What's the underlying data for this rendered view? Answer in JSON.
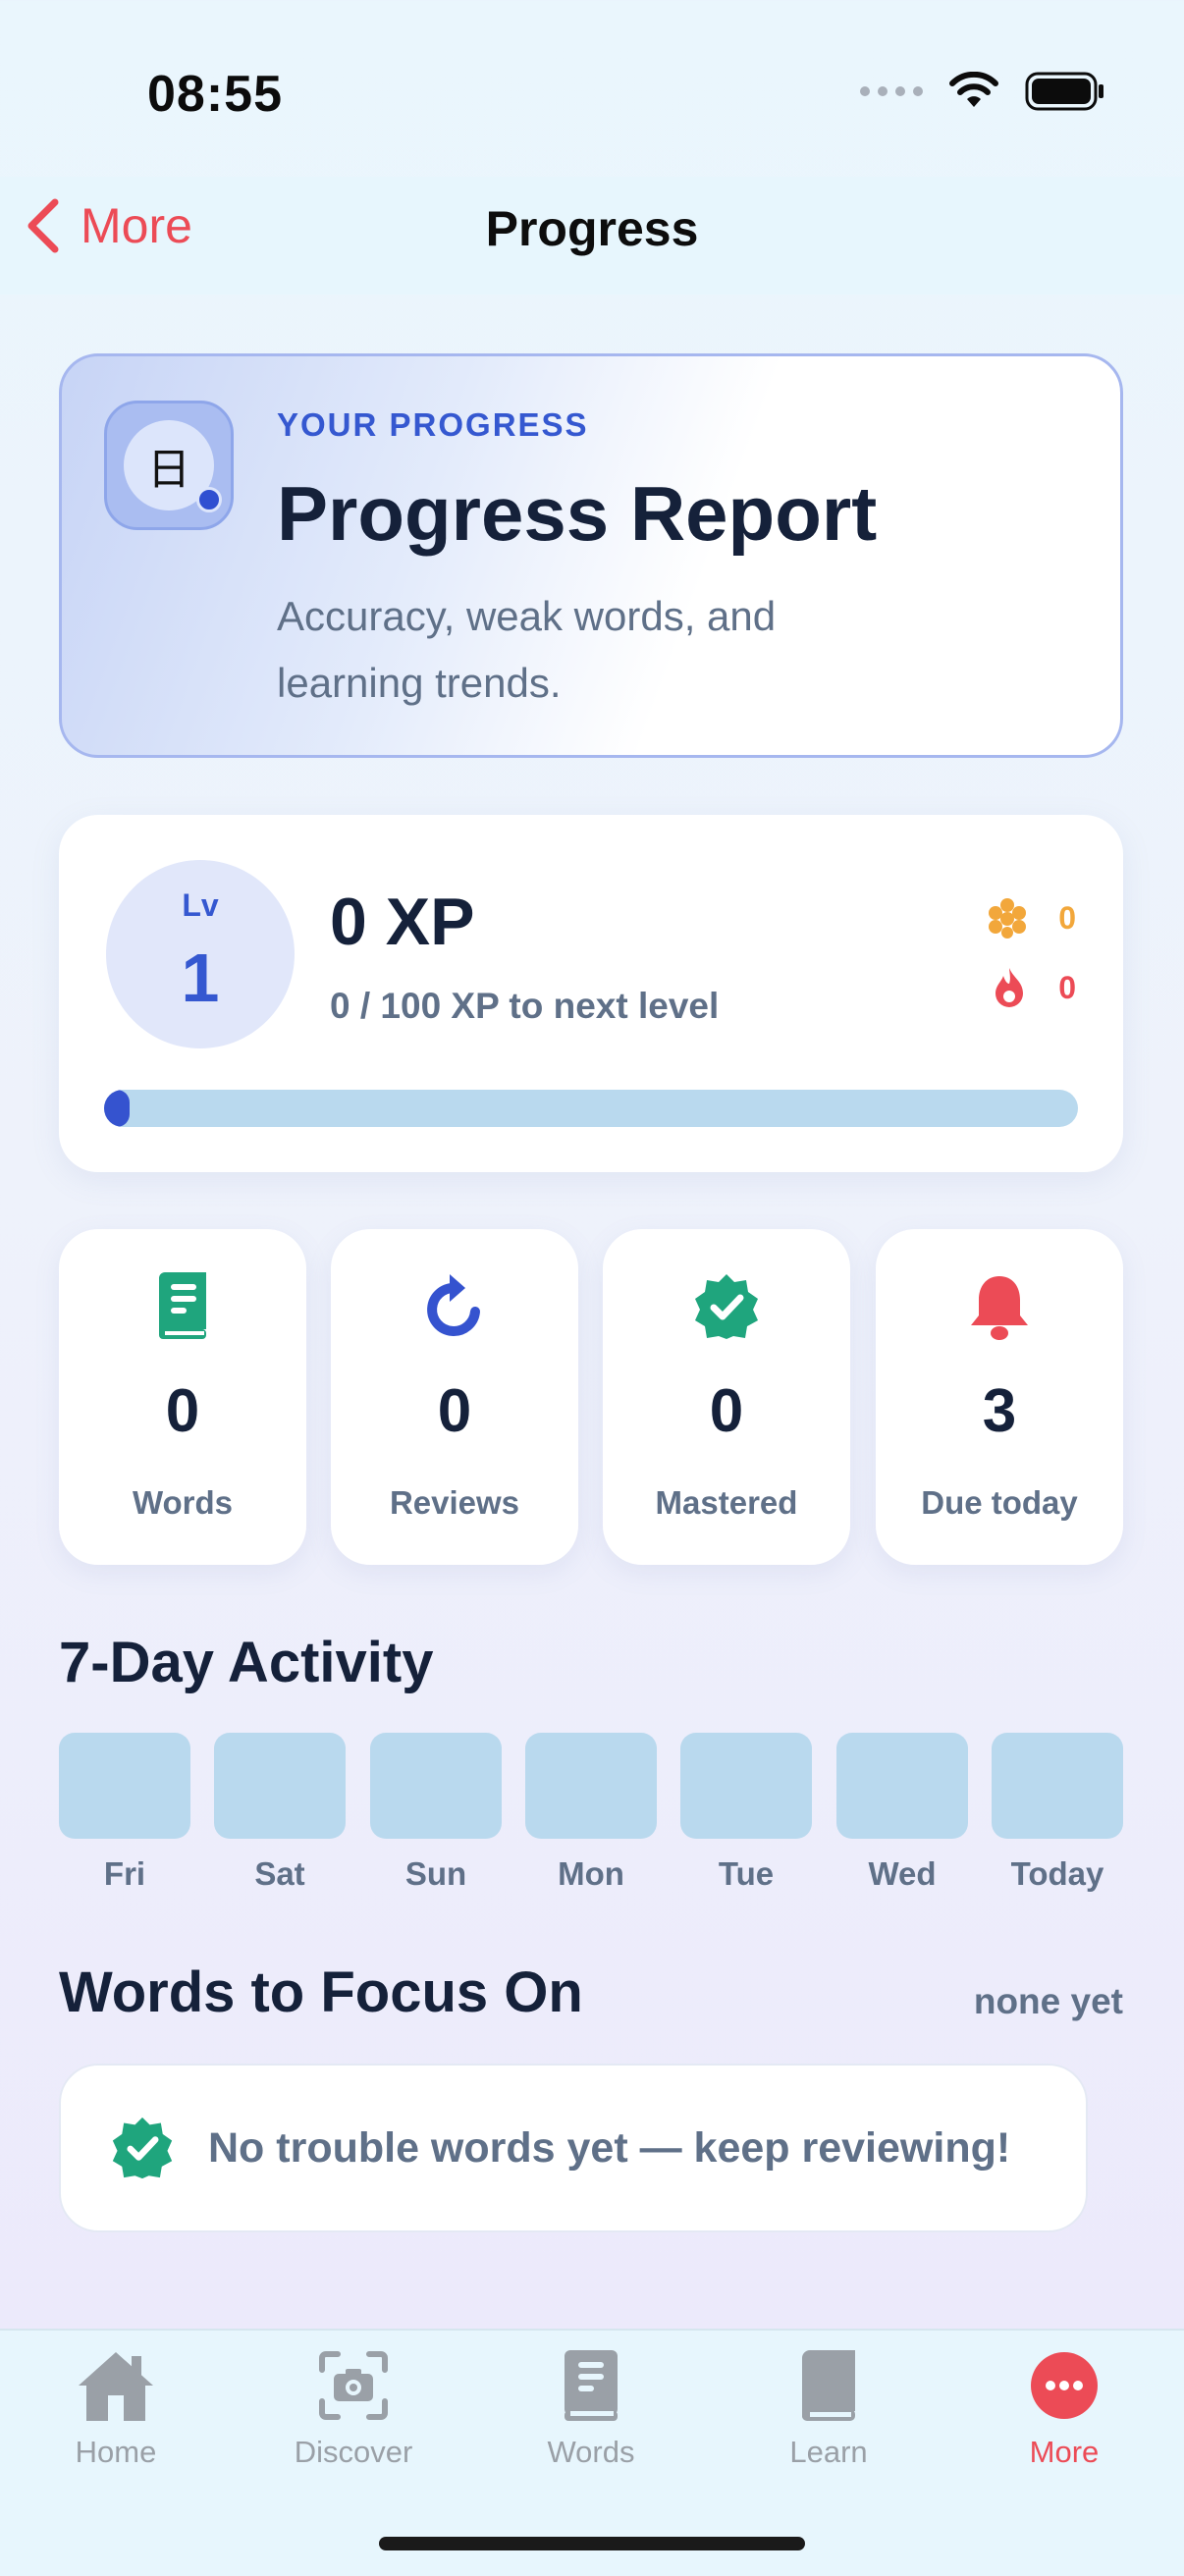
{
  "status_bar": {
    "time": "08:55"
  },
  "nav": {
    "back_label": "More",
    "title": "Progress"
  },
  "hero": {
    "icon_glyph": "日",
    "eyebrow": "YOUR PROGRESS",
    "title": "Progress Report",
    "subtitle": "Accuracy, weak words, and learning trends."
  },
  "level": {
    "lv_label": "Lv",
    "lv_value": "1",
    "xp": "0 XP",
    "xp_to_next": "0 / 100 XP to next level",
    "honey_count": "0",
    "streak_count": "0",
    "progress_fraction": 0.0
  },
  "stats": [
    {
      "icon": "book-icon",
      "value": "0",
      "label": "Words",
      "color": "#1fa57d"
    },
    {
      "icon": "refresh-icon",
      "value": "0",
      "label": "Reviews",
      "color": "#3553cf"
    },
    {
      "icon": "verified-badge-icon",
      "value": "0",
      "label": "Mastered",
      "color": "#1fa57d"
    },
    {
      "icon": "bell-icon",
      "value": "3",
      "label": "Due today",
      "color": "#ec4b56"
    }
  ],
  "activity": {
    "heading": "7-Day Activity",
    "days": [
      "Fri",
      "Sat",
      "Sun",
      "Mon",
      "Tue",
      "Wed",
      "Today"
    ]
  },
  "focus": {
    "heading": "Words to Focus On",
    "meta": "none yet",
    "empty_message": "No trouble words yet — keep reviewing!"
  },
  "tabs": [
    {
      "icon": "home-icon",
      "label": "Home",
      "active": false
    },
    {
      "icon": "camera-icon",
      "label": "Discover",
      "active": false
    },
    {
      "icon": "notebook-icon",
      "label": "Words",
      "active": false
    },
    {
      "icon": "book-icon",
      "label": "Learn",
      "active": false
    },
    {
      "icon": "more-icon",
      "label": "More",
      "active": true
    }
  ],
  "colors": {
    "accent_red": "#ec4b56",
    "accent_blue": "#3553cf",
    "accent_green": "#1fa57d",
    "honey": "#f2a73b"
  }
}
